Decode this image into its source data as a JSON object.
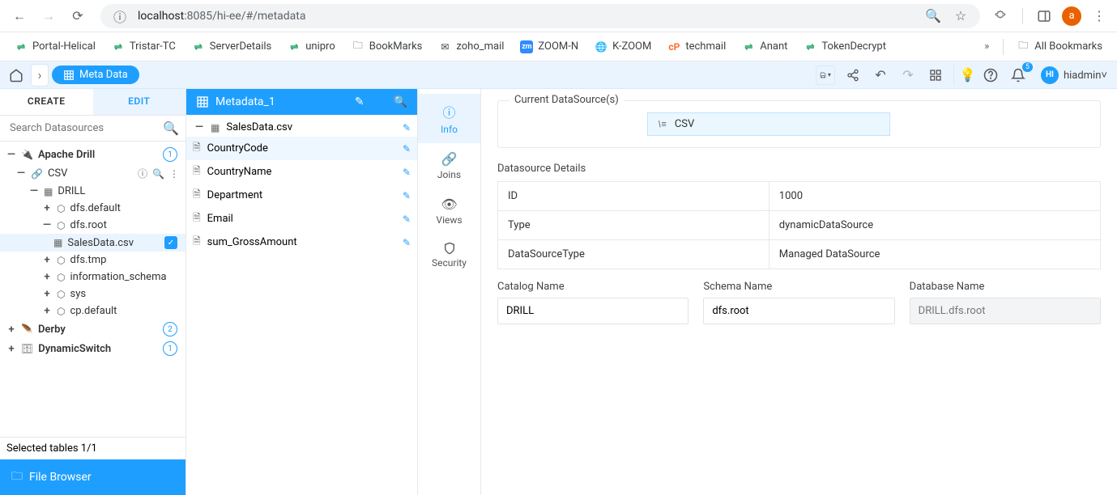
{
  "browser": {
    "url_host": "localhost",
    "url_port_path": ":8085/hi-ee/#/metadata",
    "avatar_letter": "a"
  },
  "bookmarks": [
    {
      "label": "Portal-Helical",
      "icon": "green"
    },
    {
      "label": "Tristar-TC",
      "icon": "green"
    },
    {
      "label": "ServerDetails",
      "icon": "green"
    },
    {
      "label": "unipro",
      "icon": "green"
    },
    {
      "label": "BookMarks",
      "icon": "folder"
    },
    {
      "label": "zoho_mail",
      "icon": "mail"
    },
    {
      "label": "ZOOM-N",
      "icon": "zoom"
    },
    {
      "label": "K-ZOOM",
      "icon": "globe"
    },
    {
      "label": "techmail",
      "icon": "cp"
    },
    {
      "label": "Anant",
      "icon": "green"
    },
    {
      "label": "TokenDecrypt",
      "icon": "green"
    }
  ],
  "all_bookmarks_label": "All Bookmarks",
  "app": {
    "tab_label": "Meta Data",
    "notif_count": "5",
    "user_initials": "HI",
    "user_name": "hiadmin"
  },
  "left": {
    "tabs": {
      "create": "CREATE",
      "edit": "EDIT"
    },
    "search_placeholder": "Search Datasources",
    "tree": {
      "apache_drill": "Apache Drill",
      "apache_count": "1",
      "csv": "CSV",
      "drill": "DRILL",
      "dfs_default": "dfs.default",
      "dfs_root": "dfs.root",
      "sales_csv": "SalesData.csv",
      "dfs_tmp": "dfs.tmp",
      "info_schema": "information_schema",
      "sys": "sys",
      "cp_default": "cp.default",
      "derby": "Derby",
      "derby_count": "2",
      "dynamic_switch": "DynamicSwitch",
      "dynamic_count": "1"
    },
    "footer": "Selected tables 1/1",
    "file_browser": "File Browser"
  },
  "mid": {
    "title": "Metadata_1",
    "rows": {
      "sales": "SalesData.csv",
      "country_code": "CountryCode",
      "country_name": "CountryName",
      "department": "Department",
      "email": "Email",
      "gross": "sum_GrossAmount"
    }
  },
  "nav": {
    "info": "Info",
    "joins": "Joins",
    "views": "Views",
    "security": "Security"
  },
  "right": {
    "current_ds_legend": "Current DataSource(s)",
    "ds_chip": "CSV",
    "details_legend": "Datasource Details",
    "id_label": "ID",
    "id_value": "1000",
    "type_label": "Type",
    "type_value": "dynamicDataSource",
    "dstype_label": "DataSourceType",
    "dstype_value": "Managed DataSource",
    "catalog_label": "Catalog Name",
    "catalog_value": "DRILL",
    "schema_label": "Schema Name",
    "schema_value": "dfs.root",
    "db_label": "Database Name",
    "db_placeholder": "DRILL.dfs.root"
  }
}
